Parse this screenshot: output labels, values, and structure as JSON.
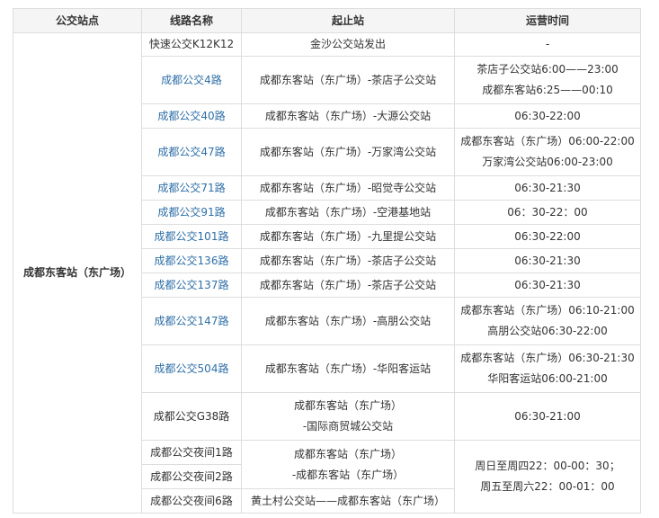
{
  "headers": [
    "公交站点",
    "线路名称",
    "起止站",
    "运营时间"
  ],
  "stop_name": "成都东客站（东广场）",
  "rows": [
    {
      "route": "快速公交K12K12",
      "link": false,
      "span": [
        "金沙公交站发出"
      ],
      "hours": [
        "-"
      ]
    },
    {
      "route": "成都公交4路",
      "link": true,
      "span": [
        "成都东客站（东广场）-茶店子公交站"
      ],
      "hours": [
        "茶店子公交站6:00——23:00",
        "成都东客站6:25——00:10"
      ]
    },
    {
      "route": "成都公交40路",
      "link": true,
      "span": [
        "成都东客站（东广场）-大源公交站"
      ],
      "hours": [
        "06:30-22:00"
      ]
    },
    {
      "route": "成都公交47路",
      "link": true,
      "span": [
        "成都东客站（东广场）-万家湾公交站"
      ],
      "hours": [
        "成都东客站（东广场）06:00-22:00",
        "万家湾公交站06:00-23:00"
      ]
    },
    {
      "route": "成都公交71路",
      "link": true,
      "span": [
        "成都东客站（东广场）-昭觉寺公交站"
      ],
      "hours": [
        "06:30-21:30"
      ]
    },
    {
      "route": "成都公交91路",
      "link": true,
      "span": [
        "成都东客站（东广场）-空港基地站"
      ],
      "hours": [
        "06：30-22：00"
      ]
    },
    {
      "route": "成都公交101路",
      "link": true,
      "span": [
        "成都东客站（东广场）-九里提公交站"
      ],
      "hours": [
        "06:30-22:00"
      ]
    },
    {
      "route": "成都公交136路",
      "link": true,
      "span": [
        "成都东客站（东广场）-茶店子公交站"
      ],
      "hours": [
        "06:30-21:30"
      ]
    },
    {
      "route": "成都公交137路",
      "link": true,
      "span": [
        "成都东客站（东广场）-茶店子公交站"
      ],
      "hours": [
        "06:30-21:30"
      ]
    },
    {
      "route": "成都公交147路",
      "link": true,
      "span": [
        "成都东客站（东广场）-高朋公交站"
      ],
      "hours": [
        "成都东客站（东广场）06:10-21:00",
        "高朋公交站06:30-22:00"
      ]
    },
    {
      "route": "成都公交504路",
      "link": true,
      "span": [
        "成都东客站（东广场）-华阳客运站"
      ],
      "hours": [
        "成都东客站（东广场）06:30-21:30",
        "华阳客运站06:00-21:00"
      ]
    },
    {
      "route": "成都公交G38路",
      "link": false,
      "span": [
        "成都东客站（东广场）",
        "-国际商贸城公交站"
      ],
      "hours": [
        "06:30-21:00"
      ]
    }
  ],
  "night": {
    "routes": [
      "成都公交夜间1路",
      "成都公交夜间2路",
      "成都公交夜间6路"
    ],
    "span_12": [
      "成都东客站（东广场）",
      "-成都东客站（东广场）"
    ],
    "span_6": "黄土村公交站——成都东客站（东广场）",
    "hours": [
      "周日至周四22：00-00：30；",
      "周五至周六22：00-01：00"
    ]
  }
}
